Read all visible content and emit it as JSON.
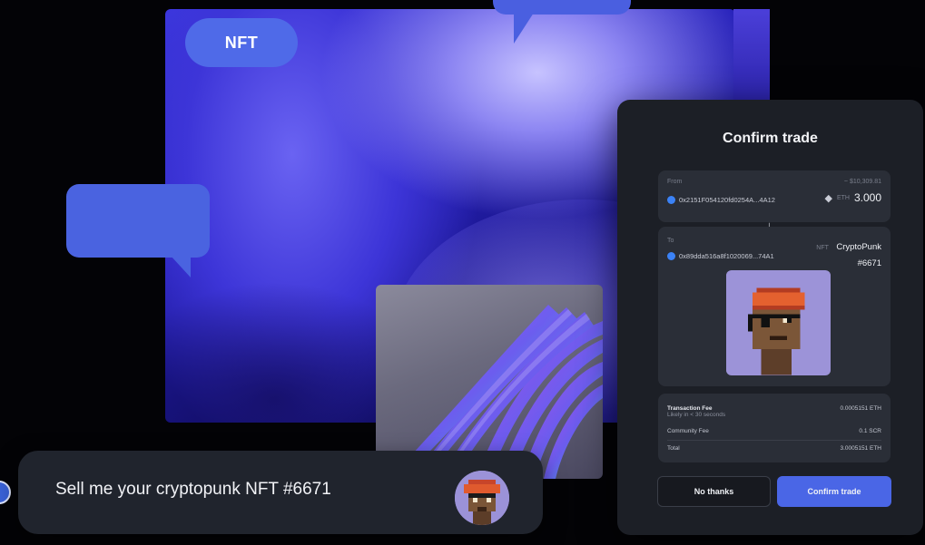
{
  "bubbles": {
    "nft_label": "NFT"
  },
  "chat": {
    "message": "Sell me your cryptopunk NFT #6671"
  },
  "confirm_trade": {
    "title": "Confirm trade",
    "from": {
      "label": "From",
      "balance": "~ $10,309.81",
      "address": "0x2151F054120fd0254A...4A12",
      "token_symbol": "ETH",
      "amount": "3.000"
    },
    "to": {
      "label": "To",
      "address": "0x89dda516a8f1020069...74A1",
      "token_symbol": "NFT",
      "nft_name": "CryptoPunk",
      "nft_number": "#6671"
    },
    "fees": {
      "transaction_fee_label": "Transaction Fee",
      "transaction_fee_note": "Likely in < 30 seconds",
      "transaction_fee_value": "0.0005151 ETH",
      "community_fee_label": "Community Fee",
      "community_fee_value": "0.1 SCR",
      "total_label": "Total",
      "total_value": "3.0005151 ETH"
    },
    "buttons": {
      "no_thanks": "No thanks",
      "confirm": "Confirm trade"
    }
  },
  "colors": {
    "accent": "#4a66e6",
    "panel_bg": "#1c1f26",
    "card_bg": "#2a2e37",
    "nft_bg": "#9c93d8"
  }
}
